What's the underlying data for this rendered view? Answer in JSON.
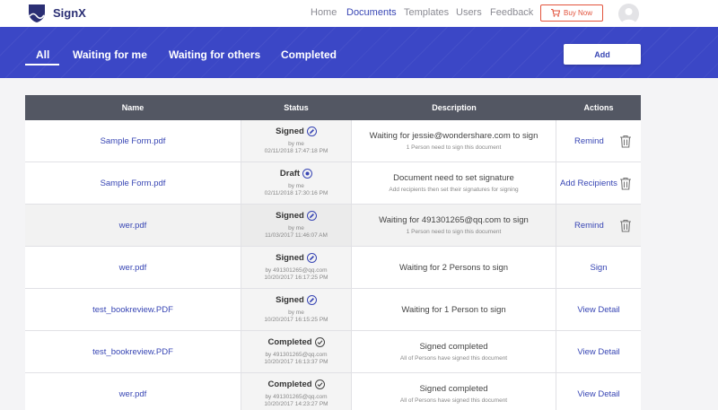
{
  "app": {
    "name": "SignX"
  },
  "nav": [
    {
      "label": "Home",
      "active": false
    },
    {
      "label": "Documents",
      "active": true
    },
    {
      "label": "Templates",
      "active": false
    },
    {
      "label": "Users",
      "active": false
    },
    {
      "label": "Feedback",
      "active": false
    }
  ],
  "buy_now": {
    "label": "Buy Now",
    "icon": "cart-icon"
  },
  "tabs": [
    {
      "label": "All",
      "active": true
    },
    {
      "label": "Waiting for me",
      "active": false
    },
    {
      "label": "Waiting for others",
      "active": false
    },
    {
      "label": "Completed",
      "active": false
    }
  ],
  "add_label": "Add",
  "table": {
    "headers": {
      "name": "Name",
      "status": "Status",
      "description": "Description",
      "actions": "Actions"
    },
    "rows": [
      {
        "name": "Sample Form.pdf",
        "status": "Signed",
        "status_icon": "pen-icon",
        "by": "by me",
        "date": "02/11/2018 17:47:18 PM",
        "desc": "Waiting for jessie@wondershare.com to sign",
        "desc_sub": "1 Person need to sign this document",
        "action": "Remind",
        "trash": true
      },
      {
        "name": "Sample Form.pdf",
        "status": "Draft",
        "status_icon": "target-icon",
        "by": "by me",
        "date": "02/11/2018 17:30:16 PM",
        "desc": "Document need to set signature",
        "desc_sub": "Add recipients then set their signatures for signing",
        "action": "Add Recipients",
        "trash": true
      },
      {
        "name": "wer.pdf",
        "status": "Signed",
        "status_icon": "pen-icon",
        "by": "by me",
        "date": "11/03/2017 11:46:07 AM",
        "desc": "Waiting for 491301265@qq.com to sign",
        "desc_sub": "1 Person need to sign this document",
        "action": "Remind",
        "trash": true
      },
      {
        "name": "wer.pdf",
        "status": "Signed",
        "status_icon": "pen-icon",
        "by": "by 491301265@qq.com",
        "date": "10/20/2017 16:17:25 PM",
        "desc": "Waiting for 2 Persons to sign",
        "desc_sub": "",
        "action": "Sign",
        "trash": false
      },
      {
        "name": "test_bookreview.PDF",
        "status": "Signed",
        "status_icon": "pen-icon",
        "by": "by me",
        "date": "10/20/2017 16:15:25 PM",
        "desc": "Waiting for 1 Person to sign",
        "desc_sub": "",
        "action": "View Detail",
        "trash": false
      },
      {
        "name": "test_bookreview.PDF",
        "status": "Completed",
        "status_icon": "check-icon",
        "by": "by 491301265@qq.com",
        "date": "10/20/2017 16:13:37 PM",
        "desc": "Signed completed",
        "desc_sub": "All of Persons have signed this document",
        "action": "View Detail",
        "trash": false
      },
      {
        "name": "wer.pdf",
        "status": "Completed",
        "status_icon": "check-icon",
        "by": "by 491301265@qq.com",
        "date": "10/20/2017 14:23:27 PM",
        "desc": "Signed completed",
        "desc_sub": "All of Persons have signed this document",
        "action": "View Detail",
        "trash": false
      }
    ]
  },
  "colors": {
    "primary": "#3b47c6",
    "accent": "#e2533c",
    "header_bg": "#535763",
    "link": "#3846b4"
  }
}
